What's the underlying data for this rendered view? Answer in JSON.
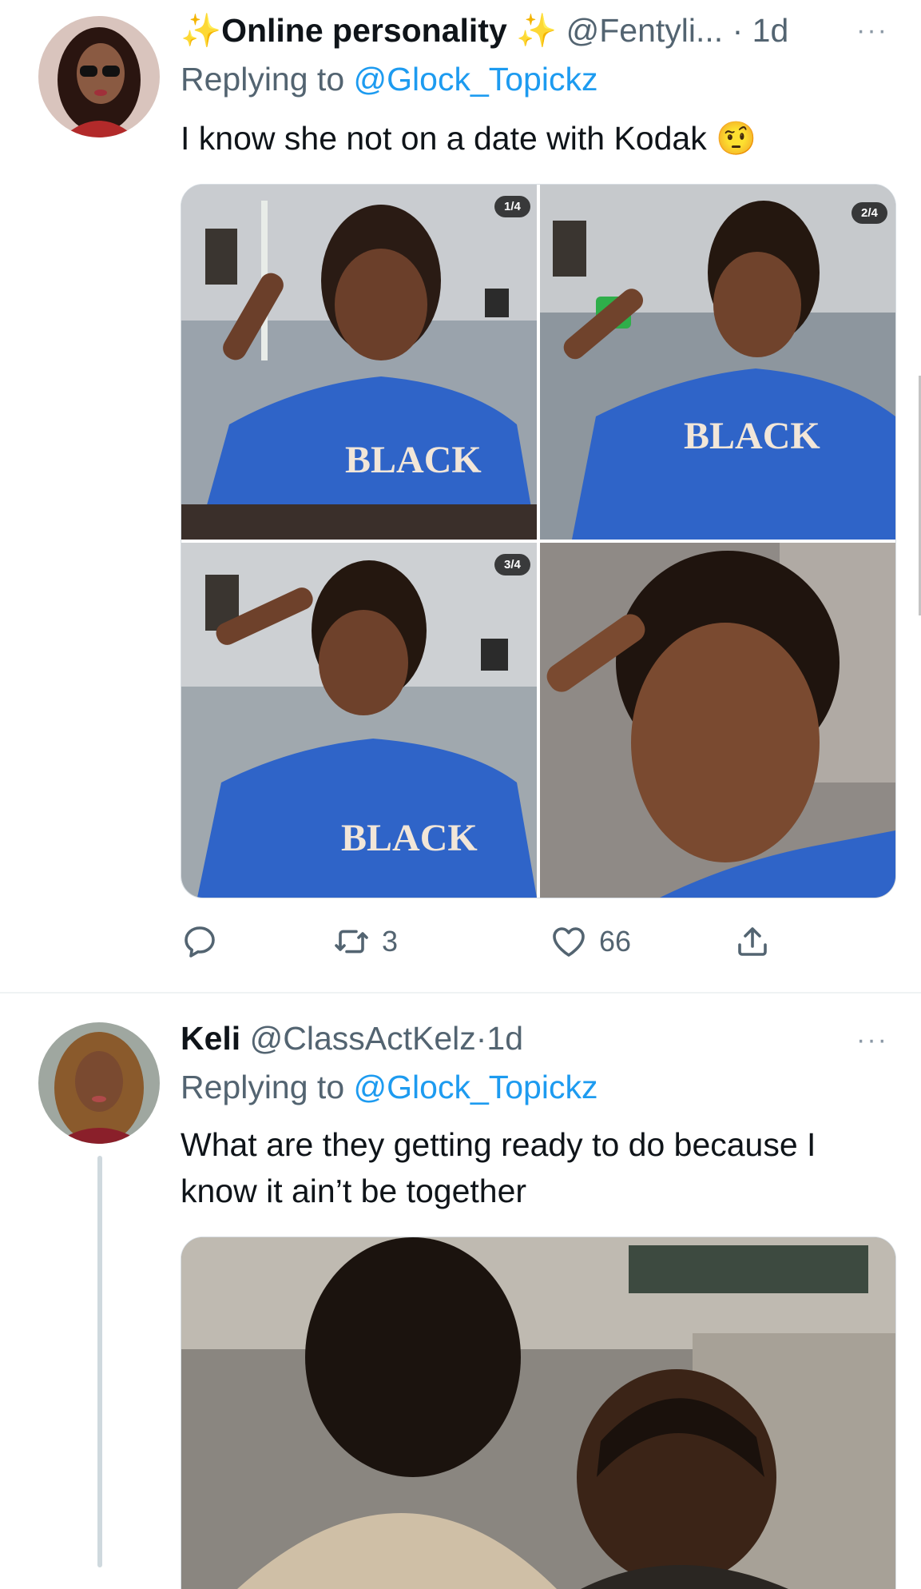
{
  "tweets": [
    {
      "sparkle_left": "✨",
      "display_name": "Online personality",
      "sparkle_right": "✨",
      "handle": "@Fentyli...",
      "separator": "·",
      "time": "1d",
      "more": "···",
      "replying_prefix": "Replying to",
      "replying_to": "@Glock_Topickz",
      "text": "I know she not on a date with Kodak",
      "emoji": "🤨",
      "media_badges": [
        "1/4",
        "2/4",
        "3/4"
      ],
      "retweet_count": "3",
      "like_count": "66"
    },
    {
      "display_name": "Keli",
      "handle": "@ClassActKelz",
      "separator": "·",
      "time": "1d",
      "more": "···",
      "replying_prefix": "Replying to",
      "replying_to": "@Glock_Topickz",
      "text_line1": "What are they getting ready to do because I",
      "text_line2": "know it ain’t be together"
    }
  ],
  "icons": {
    "reply": "reply-icon",
    "retweet": "retweet-icon",
    "like": "heart-icon",
    "share": "share-icon",
    "more": "more-icon"
  }
}
